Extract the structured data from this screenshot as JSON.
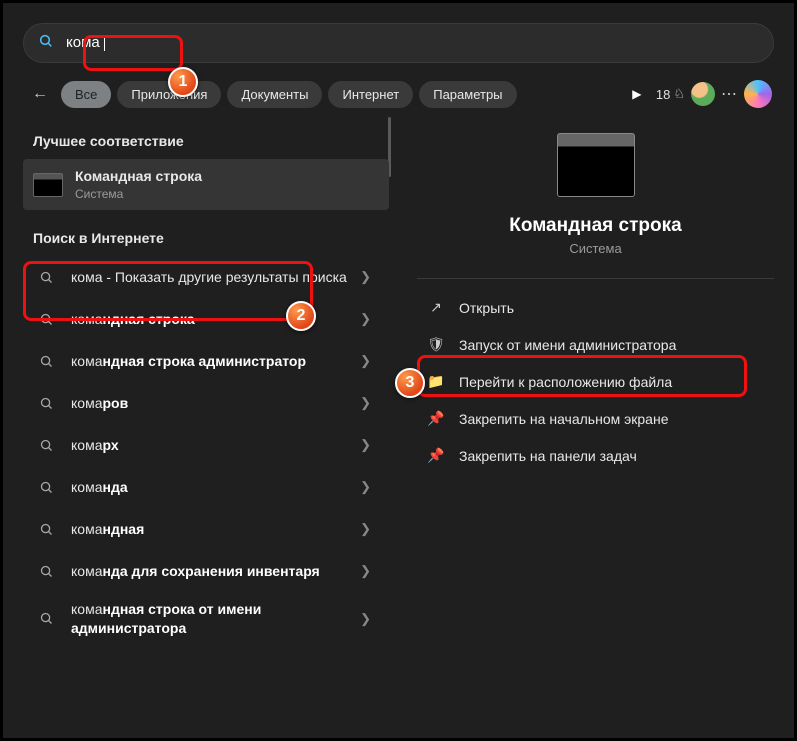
{
  "search": {
    "query": "кома"
  },
  "tabs": {
    "all": "Все",
    "apps": "Приложения",
    "documents": "Документы",
    "internet": "Интернет",
    "settings": "Параметры"
  },
  "rewards_count": "18",
  "section": {
    "best_match": "Лучшее соответствие",
    "web": "Поиск в Интернете"
  },
  "best_match": {
    "title": "Командная строка",
    "subtitle": "Система"
  },
  "web_results": [
    {
      "prefix": "кома",
      "bold": "",
      "suffix": " - Показать другие результаты поиска"
    },
    {
      "prefix": "кома",
      "bold": "ндная строка",
      "suffix": ""
    },
    {
      "prefix": "кома",
      "bold": "ндная строка администратор",
      "suffix": ""
    },
    {
      "prefix": "кома",
      "bold": "ров",
      "suffix": ""
    },
    {
      "prefix": "кома",
      "bold": "рх",
      "suffix": ""
    },
    {
      "prefix": "кома",
      "bold": "нда",
      "suffix": ""
    },
    {
      "prefix": "кома",
      "bold": "ндная",
      "suffix": ""
    },
    {
      "prefix": "кома",
      "bold": "нда для сохранения инвентаря",
      "suffix": ""
    },
    {
      "prefix": "кома",
      "bold": "ндная строка от имени администратора",
      "suffix": ""
    }
  ],
  "preview": {
    "title": "Командная строка",
    "subtitle": "Система"
  },
  "actions": {
    "open": "Открыть",
    "run_admin": "Запуск от имени администратора",
    "open_location": "Перейти к расположению файла",
    "pin_start": "Закрепить на начальном экране",
    "pin_taskbar": "Закрепить на панели задач"
  },
  "callouts": {
    "c1": "1",
    "c2": "2",
    "c3": "3"
  }
}
